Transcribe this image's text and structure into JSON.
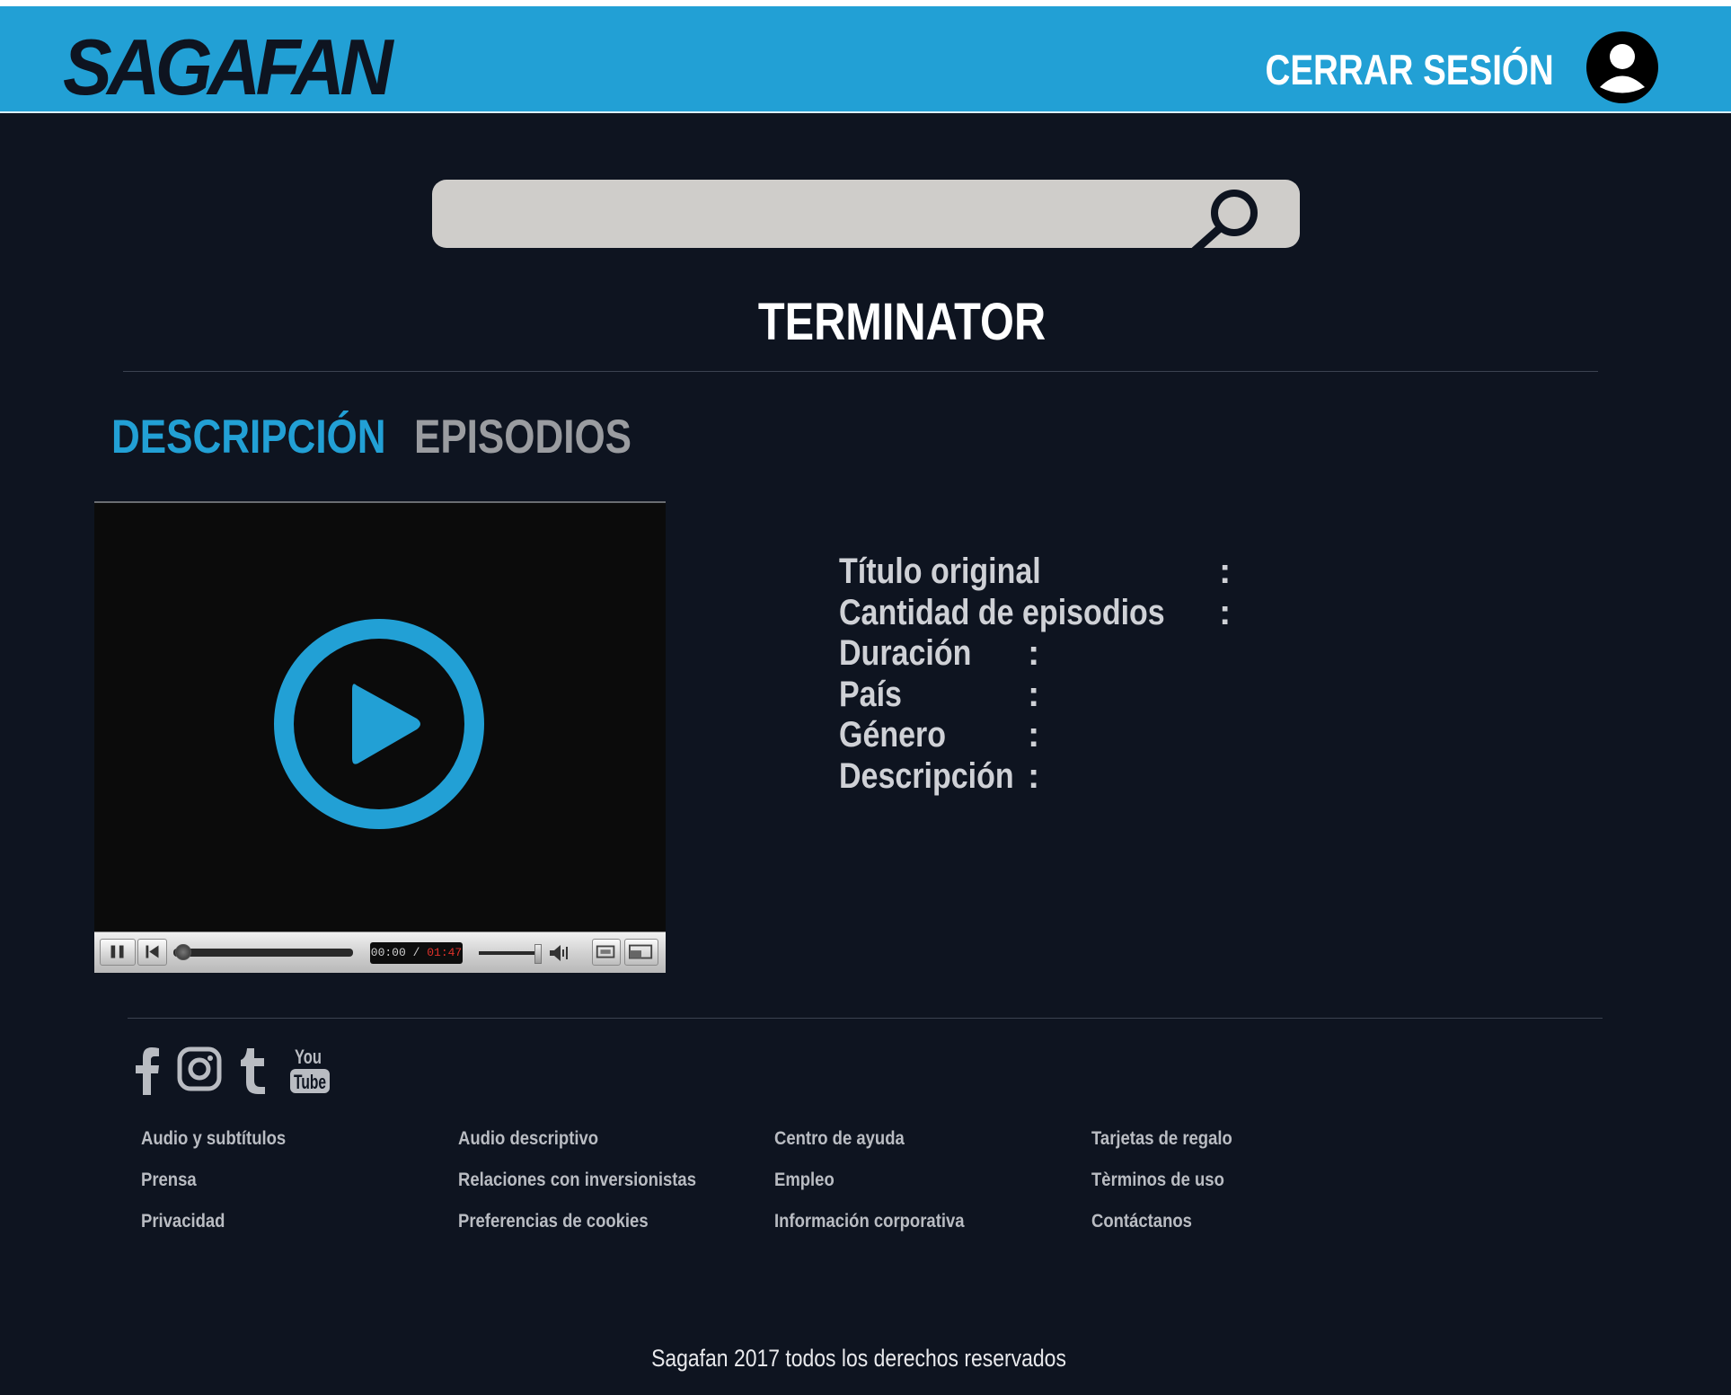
{
  "header": {
    "logo_text": "SAGAFAN",
    "logout_label": "CERRAR SESIÓN",
    "brand_color": "#22a0d5"
  },
  "search": {
    "placeholder": "",
    "value": ""
  },
  "title": "TERMINATOR",
  "tabs": [
    {
      "label": "DESCRIPCIÓN",
      "active": true
    },
    {
      "label": "EPISODIOS",
      "active": false
    }
  ],
  "player": {
    "current_time": "00:00",
    "separator": "/",
    "total_time": "01:47"
  },
  "info": [
    {
      "label": "Título original"
    },
    {
      "label": "Cantidad de episodios"
    },
    {
      "label": "Duración"
    },
    {
      "label": "País"
    },
    {
      "label": "Género"
    },
    {
      "label": "Descripción"
    }
  ],
  "colon": ":",
  "social": [
    "facebook-icon",
    "instagram-icon",
    "tumblr-icon",
    "youtube-icon"
  ],
  "footer_links": [
    [
      "Audio y subtítulos",
      "Prensa",
      "Privacidad"
    ],
    [
      "Audio descriptivo",
      "Relaciones con inversionistas",
      "Preferencias de cookies"
    ],
    [
      "Centro de ayuda",
      "Empleo",
      "Información corporativa"
    ],
    [
      "Tarjetas de regalo",
      "Tèrminos de uso",
      "Contáctanos"
    ]
  ],
  "copyright": "Sagafan 2017 todos los derechos reservados"
}
